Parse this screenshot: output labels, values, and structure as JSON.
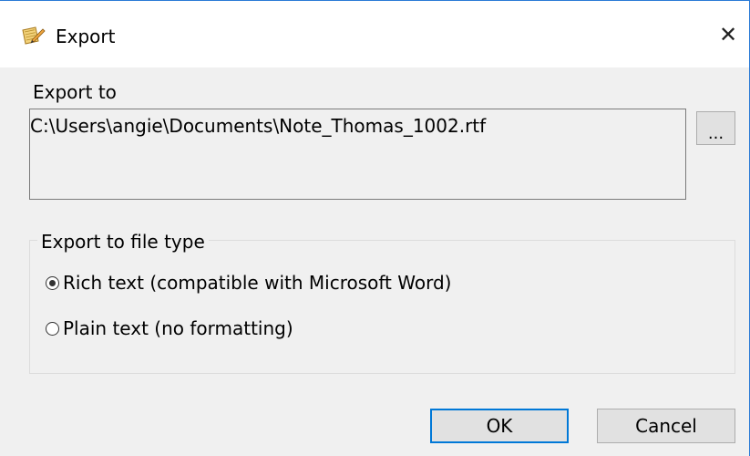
{
  "window": {
    "title": "Export",
    "icon": "notebook-pencil-icon",
    "close_glyph": "✕"
  },
  "export_to": {
    "label": "Export to",
    "path": "C:\\Users\\angie\\Documents\\Note_Thomas_1002.rtf",
    "browse_label": "..."
  },
  "file_type": {
    "legend": "Export to file type",
    "options": [
      {
        "label": "Rich text (compatible with Microsoft Word)",
        "selected": true
      },
      {
        "label": "Plain text (no formatting)",
        "selected": false
      }
    ]
  },
  "buttons": {
    "ok": "OK",
    "cancel": "Cancel"
  },
  "colors": {
    "accent": "#0078d7",
    "window_border": "#2b7bd6",
    "dialog_bg": "#f0f0f0"
  }
}
